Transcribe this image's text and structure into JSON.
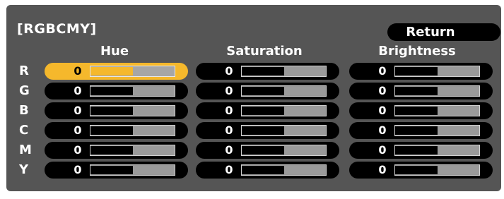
{
  "panel": {
    "title": "[RGBCMY]",
    "return_label": "Return"
  },
  "columns": [
    {
      "label": "Hue"
    },
    {
      "label": "Saturation"
    },
    {
      "label": "Brightness"
    }
  ],
  "rows": [
    {
      "label": "R",
      "values": [
        "0",
        "0",
        "0"
      ],
      "levels": [
        0.5,
        0.5,
        0.5
      ]
    },
    {
      "label": "G",
      "values": [
        "0",
        "0",
        "0"
      ],
      "levels": [
        0.5,
        0.5,
        0.5
      ]
    },
    {
      "label": "B",
      "values": [
        "0",
        "0",
        "0"
      ],
      "levels": [
        0.5,
        0.5,
        0.5
      ]
    },
    {
      "label": "C",
      "values": [
        "0",
        "0",
        "0"
      ],
      "levels": [
        0.5,
        0.5,
        0.5
      ]
    },
    {
      "label": "M",
      "values": [
        "0",
        "0",
        "0"
      ],
      "levels": [
        0.5,
        0.5,
        0.5
      ]
    },
    {
      "label": "Y",
      "values": [
        "0",
        "0",
        "0"
      ],
      "levels": [
        0.5,
        0.5,
        0.5
      ]
    }
  ],
  "selected": {
    "row": 0,
    "column": 0
  },
  "colors": {
    "panel_bg": "#555555",
    "highlight": "#f5b82c",
    "pill_bg": "#000000",
    "track": "#9a9a9a"
  }
}
